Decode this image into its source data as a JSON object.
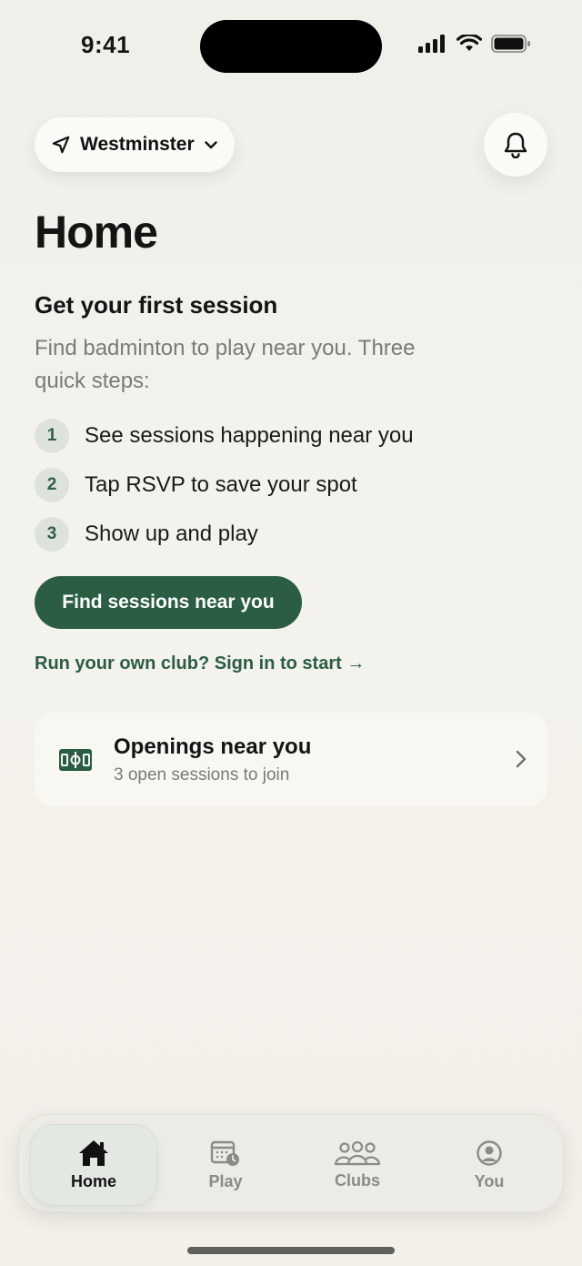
{
  "status_bar": {
    "time": "9:41",
    "icons": [
      "signal-icon",
      "wifi-icon",
      "battery-icon"
    ]
  },
  "header": {
    "location": "Westminster",
    "location_icon": "navigation-arrow-icon",
    "dropdown_icon": "chevron-down-icon",
    "notifications_icon": "bell-icon"
  },
  "page": {
    "title": "Home"
  },
  "onboarding": {
    "heading": "Get your first session",
    "description": "Find badminton to play near you. Three quick steps:",
    "steps": [
      {
        "number": "1",
        "text": "See sessions happening near you"
      },
      {
        "number": "2",
        "text": "Tap RSVP to save your spot"
      },
      {
        "number": "3",
        "text": "Show up and play"
      }
    ],
    "cta_label": "Find sessions near you",
    "club_link": "Run your own club? Sign in to start →"
  },
  "openings_card": {
    "icon": "court-icon",
    "title": "Openings near you",
    "subtitle": "3 open sessions to join"
  },
  "tab_bar": {
    "tabs": [
      {
        "label": "Home",
        "icon": "house-icon",
        "active": true
      },
      {
        "label": "Play",
        "icon": "calendar-clock-icon",
        "active": false
      },
      {
        "label": "Clubs",
        "icon": "people-group-icon",
        "active": false
      },
      {
        "label": "You",
        "icon": "user-circle-icon",
        "active": false
      }
    ]
  },
  "colors": {
    "accent": "#2a5d43",
    "background": "#f2f0ea",
    "muted_text": "#7b7b76"
  }
}
